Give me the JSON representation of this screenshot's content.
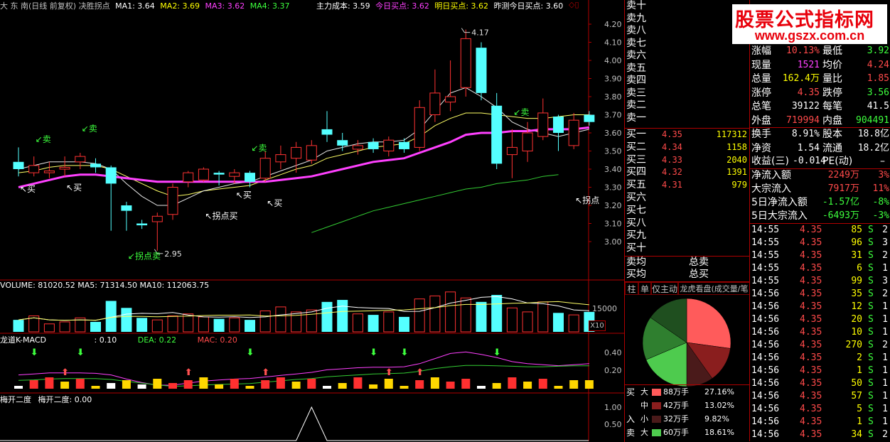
{
  "header": {
    "title": "大 东 南(日线 前复权) 决胜拐点",
    "ma1": "MA1: 3.64",
    "ma2": "MA2: 3.69",
    "ma3": "MA3: 3.62",
    "ma4": "MA4: 3.37",
    "cost": "主力成本: 3.59",
    "today_buy": "今日买点: 3.62",
    "tomorrow_buy": "明日买点: 3.62",
    "yest_buy": "昨测今日买点: 3.60"
  },
  "colors": {
    "up": "#ff3232",
    "down": "#54ffff",
    "ma_yellow": "#ffff66",
    "ma_white": "#e8e8e8",
    "ma_mag": "#ff40ff",
    "ma_green": "#33cc33",
    "border": "#b00000"
  },
  "price_axis": {
    "labels": [
      "4.20",
      "4.10",
      "4.00",
      "3.90",
      "3.80",
      "3.70",
      "3.60",
      "3.50",
      "3.40",
      "3.30",
      "3.20",
      "3.10",
      "3.00"
    ]
  },
  "annotations": {
    "high": "4.17",
    "low": "2.95",
    "sell": "卖",
    "buy": "买",
    "sell_turn": "拐点卖",
    "buy_turn": "拐点买",
    "turn": "拐点"
  },
  "volume": {
    "header": "VOLUME: 81020.52  MA5: 71314.50  MA10: 112063.75",
    "axis": "15000",
    "unit": "X10"
  },
  "macd": {
    "header_name": "龙道K-MACD",
    "header_val": ": 0.10",
    "dea": "DEA: 0.22",
    "mac": "MAC: 0.20",
    "axis": [
      "0.40",
      "0.20"
    ]
  },
  "mei": {
    "header_name": "梅开二度",
    "header_val": "梅开二度: 0.00",
    "axis": [
      "1.00",
      "0.50"
    ]
  },
  "watermark": {
    "line1": "股票公式指标网",
    "line2": "www.gszx.com.cn"
  },
  "orderbook": {
    "sell_labels": [
      "卖十",
      "卖九",
      "卖八",
      "卖七",
      "卖六",
      "卖五",
      "卖四",
      "卖三",
      "卖二",
      "卖一"
    ],
    "buy_rows": [
      {
        "label": "买一",
        "price": "4.35",
        "vol": "117312"
      },
      {
        "label": "买二",
        "price": "4.34",
        "vol": "1158"
      },
      {
        "label": "买三",
        "price": "4.33",
        "vol": "2040"
      },
      {
        "label": "买四",
        "price": "4.32",
        "vol": "1391"
      },
      {
        "label": "买五",
        "price": "4.31",
        "vol": "979"
      },
      {
        "label": "买六",
        "price": "",
        "vol": ""
      },
      {
        "label": "买七",
        "price": "",
        "vol": ""
      },
      {
        "label": "买八",
        "price": "",
        "vol": ""
      },
      {
        "label": "买九",
        "price": "",
        "vol": ""
      },
      {
        "label": "买十",
        "price": "",
        "vol": ""
      }
    ],
    "avg_sell": "卖均",
    "avg_buy": "买均",
    "total_sell": "总卖",
    "total_buy": "总买"
  },
  "tabs": [
    "柱",
    "单",
    "仅主动",
    "龙虎看盘(成交量/笔"
  ],
  "flow": {
    "side_buy": "买",
    "side_buy2": "入",
    "side_sell": "卖",
    "rows": [
      {
        "size": "大",
        "color": "#ff5b5b",
        "label": "88万手",
        "pct": "27.16%"
      },
      {
        "size": "中",
        "color": "#8a1e1e",
        "label": "42万手",
        "pct": "13.02%"
      },
      {
        "size": "小",
        "color": "#4a1a1a",
        "label": "32万手",
        "pct": "9.82%"
      },
      {
        "size": "大",
        "color": "#4ecb4e",
        "label": "60万手",
        "pct": "18.61%"
      }
    ],
    "pie": [
      27.16,
      13.02,
      9.82,
      18.61,
      16.0,
      15.39
    ],
    "pie_colors": [
      "#ff5b5b",
      "#8a1e1e",
      "#4a1a1a",
      "#4ecb4e",
      "#2f7f2f",
      "#1f4f1f"
    ]
  },
  "quote": [
    {
      "l1": "涨幅",
      "v1": "10.13%",
      "c1": "red",
      "l2": "最低",
      "v2": "3.92",
      "c2": "green"
    },
    {
      "l1": "现量",
      "v1": "1521",
      "c1": "mag",
      "l2": "均价",
      "v2": "4.24",
      "c2": "red"
    },
    {
      "l1": "总量",
      "v1": "162.4万",
      "c1": "yellow",
      "l2": "量比",
      "v2": "1.85",
      "c2": "red"
    },
    {
      "l1": "涨停",
      "v1": "4.35",
      "c1": "red",
      "l2": "跌停",
      "v2": "3.56",
      "c2": "green"
    },
    {
      "l1": "总笔",
      "v1": "39122",
      "c1": "white",
      "l2": "每笔",
      "v2": "41.5",
      "c2": "white"
    },
    {
      "l1": "外盘",
      "v1": "719994",
      "c1": "red",
      "l2": "内盘",
      "v2": "904491",
      "c2": "green"
    },
    {
      "l1": "换手",
      "v1": "8.91%",
      "c1": "white",
      "l2": "股本",
      "v2": "18.8亿",
      "c2": "white"
    },
    {
      "l1": "净资",
      "v1": "1.54",
      "c1": "white",
      "l2": "流通",
      "v2": "18.2亿",
      "c2": "white"
    }
  ],
  "eps": {
    "label": "收益(三)",
    "value": "-0.014",
    "pe": "PE(动)",
    "pe_val": "–"
  },
  "capital": [
    {
      "label": "净流入额",
      "value": "2249万",
      "pct": "3%",
      "c": "red"
    },
    {
      "label": "大宗流入",
      "value": "7917万",
      "pct": "11%",
      "c": "red"
    },
    {
      "label": "5日净流入额",
      "value": "-1.57亿",
      "pct": "-8%",
      "c": "green"
    },
    {
      "label": "5日大宗流入",
      "value": "-6493万",
      "pct": "-3%",
      "c": "green"
    }
  ],
  "ticks": [
    {
      "t": "14:55",
      "p": "4.35",
      "v": "85",
      "s": "S",
      "n": "2"
    },
    {
      "t": "14:55",
      "p": "4.35",
      "v": "96",
      "s": "S",
      "n": "3"
    },
    {
      "t": "14:55",
      "p": "4.35",
      "v": "31",
      "s": "S",
      "n": "2"
    },
    {
      "t": "14:55",
      "p": "4.35",
      "v": "6",
      "s": "S",
      "n": "1"
    },
    {
      "t": "14:55",
      "p": "4.35",
      "v": "99",
      "s": "S",
      "n": "3"
    },
    {
      "t": "14:56",
      "p": "4.35",
      "v": "35",
      "s": "S",
      "n": "2"
    },
    {
      "t": "14:56",
      "p": "4.35",
      "v": "12",
      "s": "S",
      "n": "1"
    },
    {
      "t": "14:56",
      "p": "4.35",
      "v": "20",
      "s": "S",
      "n": "1"
    },
    {
      "t": "14:56",
      "p": "4.35",
      "v": "10",
      "s": "S",
      "n": "1"
    },
    {
      "t": "14:56",
      "p": "4.35",
      "v": "270",
      "s": "S",
      "n": "2"
    },
    {
      "t": "14:56",
      "p": "4.35",
      "v": "2",
      "s": "S",
      "n": "1"
    },
    {
      "t": "14:56",
      "p": "4.35",
      "v": "1",
      "s": "S",
      "n": "1"
    },
    {
      "t": "14:56",
      "p": "4.35",
      "v": "50",
      "s": "S",
      "n": "1"
    },
    {
      "t": "14:56",
      "p": "4.35",
      "v": "57",
      "s": "S",
      "n": "1"
    },
    {
      "t": "14:56",
      "p": "4.35",
      "v": "5",
      "s": "S",
      "n": "1"
    },
    {
      "t": "14:56",
      "p": "4.35",
      "v": "1",
      "s": "S",
      "n": "1"
    },
    {
      "t": "14:56",
      "p": "4.35",
      "v": "34",
      "s": "S",
      "n": "2"
    }
  ],
  "chart_data": {
    "type": "candlestick",
    "ylim": [
      2.95,
      4.22
    ],
    "candles": [
      {
        "o": 3.44,
        "c": 3.4,
        "h": 3.52,
        "l": 3.36
      },
      {
        "o": 3.38,
        "c": 3.42,
        "h": 3.47,
        "l": 3.36
      },
      {
        "o": 3.38,
        "c": 3.39,
        "h": 3.44,
        "l": 3.35
      },
      {
        "o": 3.4,
        "c": 3.41,
        "h": 3.47,
        "l": 3.36
      },
      {
        "o": 3.44,
        "c": 3.47,
        "h": 3.49,
        "l": 3.4
      },
      {
        "o": 3.43,
        "c": 3.41,
        "h": 3.46,
        "l": 3.38
      },
      {
        "o": 3.41,
        "c": 3.32,
        "h": 3.42,
        "l": 3.06
      },
      {
        "o": 3.2,
        "c": 3.17,
        "h": 3.22,
        "l": 3.06
      },
      {
        "o": 3.1,
        "c": 3.09,
        "h": 3.12,
        "l": 3.07
      },
      {
        "o": 3.11,
        "c": 3.14,
        "h": 3.16,
        "l": 2.95
      },
      {
        "o": 3.15,
        "c": 3.3,
        "h": 3.32,
        "l": 3.12
      },
      {
        "o": 3.33,
        "c": 3.38,
        "h": 3.39,
        "l": 3.3
      },
      {
        "o": 3.34,
        "c": 3.4,
        "h": 3.41,
        "l": 3.33
      },
      {
        "o": 3.38,
        "c": 3.37,
        "h": 3.39,
        "l": 3.31
      },
      {
        "o": 3.36,
        "c": 3.38,
        "h": 3.4,
        "l": 3.32
      },
      {
        "o": 3.38,
        "c": 3.33,
        "h": 3.39,
        "l": 3.3
      },
      {
        "o": 3.35,
        "c": 3.46,
        "h": 3.5,
        "l": 3.33
      },
      {
        "o": 3.44,
        "c": 3.48,
        "h": 3.53,
        "l": 3.4
      },
      {
        "o": 3.46,
        "c": 3.52,
        "h": 3.55,
        "l": 3.38
      },
      {
        "o": 3.45,
        "c": 3.53,
        "h": 3.56,
        "l": 3.43
      },
      {
        "o": 3.62,
        "c": 3.59,
        "h": 3.72,
        "l": 3.55
      },
      {
        "o": 3.56,
        "c": 3.53,
        "h": 3.6,
        "l": 3.5
      },
      {
        "o": 3.51,
        "c": 3.53,
        "h": 3.56,
        "l": 3.48
      },
      {
        "o": 3.55,
        "c": 3.51,
        "h": 3.57,
        "l": 3.49
      },
      {
        "o": 3.5,
        "c": 3.56,
        "h": 3.58,
        "l": 3.47
      },
      {
        "o": 3.55,
        "c": 3.51,
        "h": 3.57,
        "l": 3.49
      },
      {
        "o": 3.52,
        "c": 3.74,
        "h": 3.78,
        "l": 3.5
      },
      {
        "o": 3.7,
        "c": 3.82,
        "h": 3.95,
        "l": 3.66
      },
      {
        "o": 3.77,
        "c": 3.8,
        "h": 4.0,
        "l": 3.72
      },
      {
        "o": 3.85,
        "c": 4.12,
        "h": 4.17,
        "l": 3.8
      },
      {
        "o": 4.07,
        "c": 3.82,
        "h": 4.1,
        "l": 3.78
      },
      {
        "o": 3.75,
        "c": 3.43,
        "h": 3.82,
        "l": 3.4
      },
      {
        "o": 3.48,
        "c": 3.52,
        "h": 3.62,
        "l": 3.35
      },
      {
        "o": 3.5,
        "c": 3.6,
        "h": 3.66,
        "l": 3.44
      },
      {
        "o": 3.58,
        "c": 3.71,
        "h": 3.79,
        "l": 3.56
      },
      {
        "o": 3.69,
        "c": 3.6,
        "h": 3.7,
        "l": 3.5
      },
      {
        "o": 3.53,
        "c": 3.67,
        "h": 3.71,
        "l": 3.51
      },
      {
        "o": 3.7,
        "c": 3.66,
        "h": 3.72,
        "l": 3.64
      }
    ],
    "volume": [
      6000,
      8000,
      4000,
      5000,
      7000,
      5000,
      15500,
      12000,
      7000,
      6000,
      8000,
      9000,
      7500,
      6500,
      7000,
      6000,
      10500,
      12500,
      10000,
      11000,
      15000,
      16000,
      9000,
      8500,
      10000,
      7500,
      16500,
      18000,
      20000,
      17000,
      15000,
      18500,
      12000,
      10000,
      15000,
      9500,
      8500,
      10000
    ],
    "ma_mag": [
      3.3,
      3.32,
      3.34,
      3.36,
      3.37,
      3.37,
      3.36,
      3.35,
      3.34,
      3.33,
      3.33,
      3.33,
      3.33,
      3.33,
      3.33,
      3.33,
      3.33,
      3.34,
      3.35,
      3.36,
      3.38,
      3.4,
      3.42,
      3.44,
      3.45,
      3.46,
      3.49,
      3.52,
      3.55,
      3.59,
      3.6,
      3.6,
      3.61,
      3.61,
      3.62,
      3.62,
      3.62,
      3.63
    ],
    "ma_white": [
      3.4,
      3.42,
      3.44,
      3.44,
      3.44,
      3.43,
      3.4,
      3.32,
      3.25,
      3.2,
      3.2,
      3.24,
      3.28,
      3.3,
      3.32,
      3.33,
      3.36,
      3.39,
      3.42,
      3.45,
      3.5,
      3.52,
      3.54,
      3.55,
      3.55,
      3.56,
      3.62,
      3.72,
      3.82,
      3.85,
      3.8,
      3.74,
      3.66,
      3.62,
      3.6,
      3.58,
      3.6,
      3.62
    ],
    "ma_yellow": [
      3.38,
      3.39,
      3.41,
      3.42,
      3.42,
      3.42,
      3.4,
      3.36,
      3.32,
      3.28,
      3.25,
      3.26,
      3.28,
      3.29,
      3.3,
      3.31,
      3.34,
      3.37,
      3.4,
      3.42,
      3.46,
      3.48,
      3.5,
      3.52,
      3.53,
      3.54,
      3.58,
      3.64,
      3.68,
      3.71,
      3.71,
      3.7,
      3.69,
      3.68,
      3.68,
      3.69,
      3.7,
      3.7
    ],
    "ma_green": [
      3.05,
      3.08,
      3.11,
      3.14,
      3.17,
      3.19,
      3.21,
      3.23,
      3.25,
      3.27,
      3.29,
      3.3,
      3.32,
      3.33,
      3.34,
      3.36,
      3.37
    ]
  }
}
